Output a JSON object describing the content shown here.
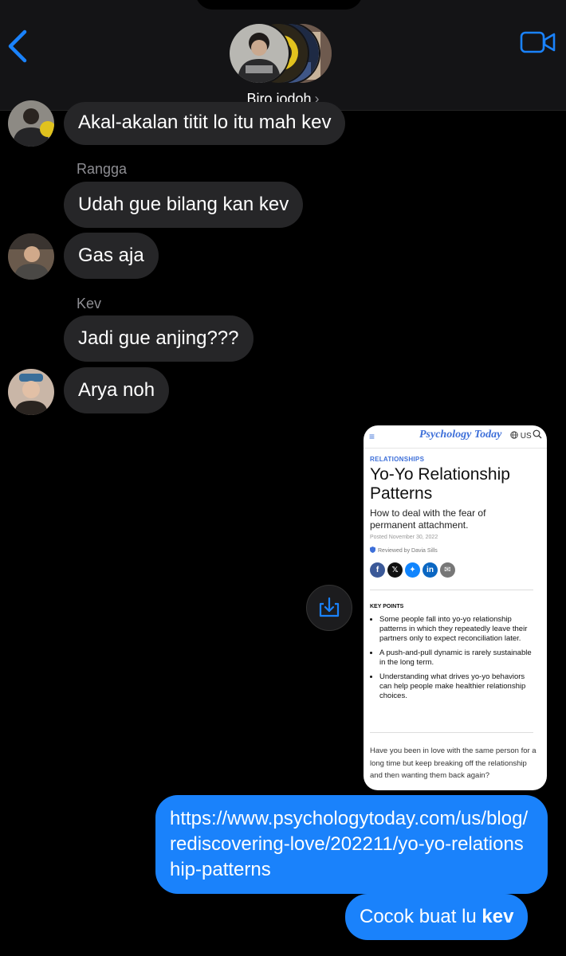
{
  "header": {
    "group_name": "Biro jodoh",
    "chevron": "›",
    "back_icon": "chevron-left-icon",
    "video_icon": "video-camera-icon",
    "accent": "#1a82fb"
  },
  "messages": [
    {
      "type": "in",
      "text": "Akal-akalan titit lo itu mah kev"
    },
    {
      "type": "in",
      "sender": "Rangga",
      "text": "Udah gue bilang kan kev"
    },
    {
      "type": "in",
      "text": "Gas aja"
    },
    {
      "type": "in",
      "sender": "Kev",
      "text": "Jadi gue anjing???"
    },
    {
      "type": "in",
      "text": "Arya noh"
    },
    {
      "type": "out",
      "text": "https://www.psychologytoday.com/us/blog/rediscovering-love/202211/yo-yo-relationship-patterns"
    },
    {
      "type": "out",
      "text_plain": "Cocok buat lu ",
      "text_bold": "kev"
    }
  ],
  "link_preview": {
    "menu_icon": "≡",
    "site_logo": "Psychology Today",
    "region": "US",
    "category": "RELATIONSHIPS",
    "title": "Yo-Yo Relationship Patterns",
    "subtitle": "How to deal with the fear of permanent attachment.",
    "posted": "Posted November 30, 2022",
    "reviewed": "Reviewed by Davia Sills",
    "key_points_heading": "KEY POINTS",
    "key_points": [
      "Some people fall into yo-yo relationship patterns in which they repeatedly leave their partners only to expect reconciliation later.",
      "A push-and-pull dynamic is rarely sustainable in the long term.",
      "Understanding what drives yo-yo behaviors can help people make healthier relationship choices."
    ],
    "body_text": "Have you been in love with the same person for a long time but keep breaking off the relationship and then wanting them back again?",
    "share_icons": [
      "f",
      "𝕏",
      "✦",
      "in",
      "✉"
    ]
  },
  "download_icon": "download-icon"
}
